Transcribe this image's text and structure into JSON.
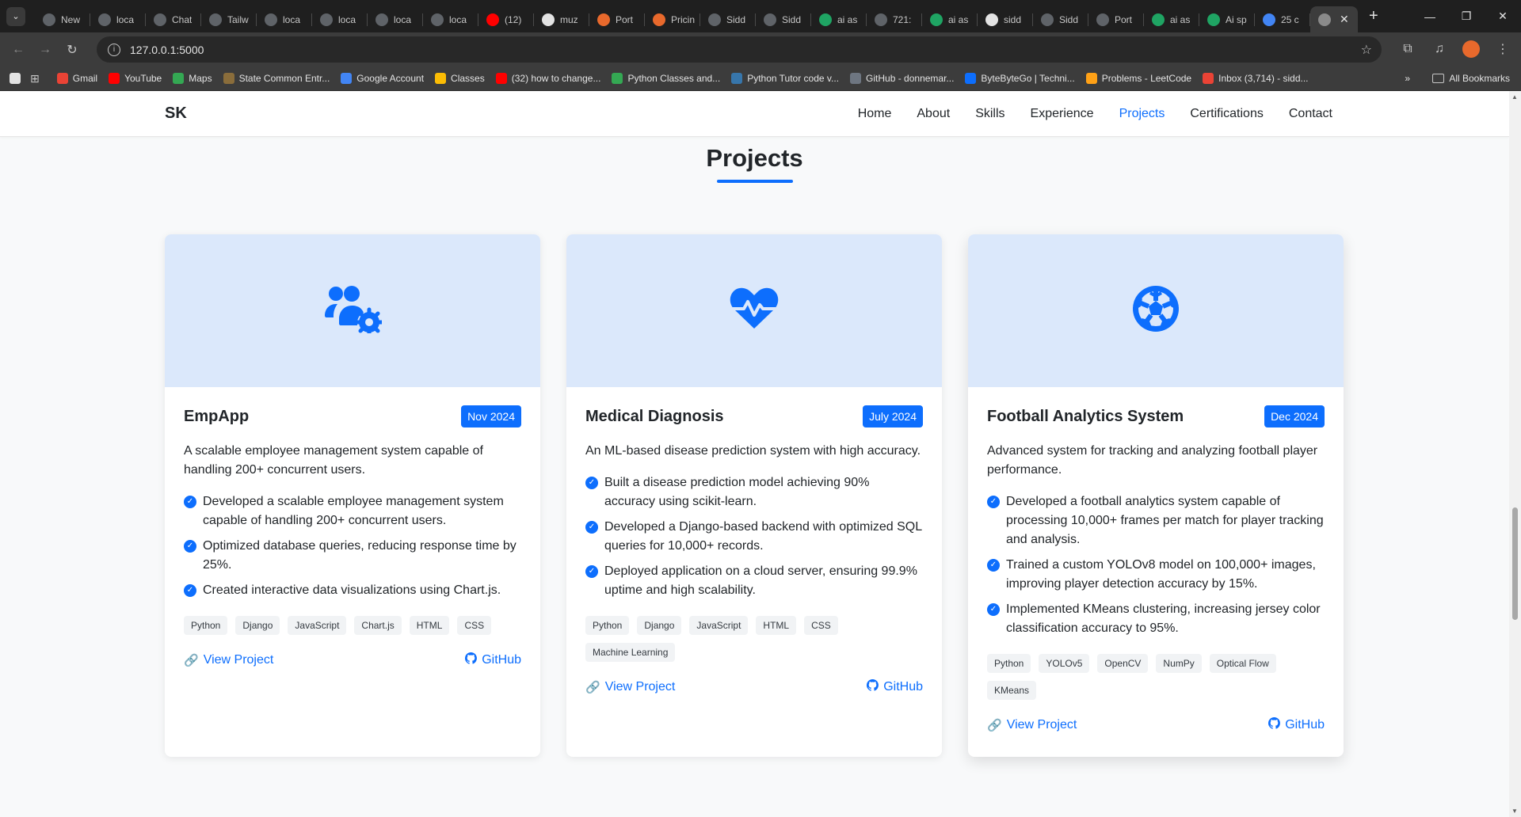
{
  "browser": {
    "tabs": [
      {
        "title": "New",
        "icon": "chrome-icon",
        "color": "#5f6368"
      },
      {
        "title": "loca",
        "icon": "globe-icon",
        "color": "#5f6368"
      },
      {
        "title": "Chat",
        "icon": "openai-icon",
        "color": "#5f6368"
      },
      {
        "title": "Tailw",
        "icon": "openai-icon",
        "color": "#5f6368"
      },
      {
        "title": "loca",
        "icon": "globe-icon",
        "color": "#5f6368"
      },
      {
        "title": "loca",
        "icon": "globe-icon",
        "color": "#5f6368"
      },
      {
        "title": "loca",
        "icon": "globe-icon",
        "color": "#5f6368"
      },
      {
        "title": "loca",
        "icon": "globe-icon",
        "color": "#5f6368"
      },
      {
        "title": "(12)",
        "icon": "youtube-icon",
        "color": "#ff0000"
      },
      {
        "title": "muz",
        "icon": "github-icon",
        "color": "#e3e3e3"
      },
      {
        "title": "Port",
        "icon": "windsurf-icon",
        "color": "#e8692c"
      },
      {
        "title": "Pricin",
        "icon": "windsurf-icon",
        "color": "#e8692c"
      },
      {
        "title": "Sidd",
        "icon": "globe-icon",
        "color": "#5f6368"
      },
      {
        "title": "Sidd",
        "icon": "globe-icon",
        "color": "#5f6368"
      },
      {
        "title": "ai as",
        "icon": "drive-icon",
        "color": "#1fa463"
      },
      {
        "title": "721:",
        "icon": "globe-icon",
        "color": "#5f6368"
      },
      {
        "title": "ai as",
        "icon": "drive-icon",
        "color": "#1fa463"
      },
      {
        "title": "sidd",
        "icon": "github-icon",
        "color": "#e3e3e3"
      },
      {
        "title": "Sidd",
        "icon": "globe-icon",
        "color": "#5f6368"
      },
      {
        "title": "Port",
        "icon": "openai-icon",
        "color": "#5f6368"
      },
      {
        "title": "ai as",
        "icon": "drive-icon",
        "color": "#1fa463"
      },
      {
        "title": "Ai sp",
        "icon": "drive-icon",
        "color": "#1fa463"
      },
      {
        "title": "25 c",
        "icon": "google-icon",
        "color": "#4285f4"
      }
    ],
    "active_tab_icon": "globe-icon",
    "close_glyph": "✕",
    "new_tab_glyph": "+",
    "url": "127.0.0.1:5000",
    "bookmarks": [
      {
        "label": "Gmail",
        "color": "#ea4335"
      },
      {
        "label": "YouTube",
        "color": "#ff0000"
      },
      {
        "label": "Maps",
        "color": "#34a853"
      },
      {
        "label": "State Common Entr...",
        "color": "#8a6d3b"
      },
      {
        "label": "Google Account",
        "color": "#4285f4"
      },
      {
        "label": "Classes",
        "color": "#fbbc04"
      },
      {
        "label": "(32) how to change...",
        "color": "#ff0000"
      },
      {
        "label": "Python Classes and...",
        "color": "#34a853"
      },
      {
        "label": "Python Tutor code v...",
        "color": "#3776ab"
      },
      {
        "label": "GitHub - donnemar...",
        "color": "#6e7681"
      },
      {
        "label": "ByteByteGo | Techni...",
        "color": "#0d6efd"
      },
      {
        "label": "Problems - LeetCode",
        "color": "#ffa116"
      },
      {
        "label": "Inbox (3,714) - sidd...",
        "color": "#ea4335"
      }
    ],
    "bookmarks_more": "»",
    "all_bookmarks": "All Bookmarks"
  },
  "site": {
    "brand": "SK",
    "nav": [
      "Home",
      "About",
      "Skills",
      "Experience",
      "Projects",
      "Certifications",
      "Contact"
    ],
    "active_nav": "Projects",
    "section_title": "Projects",
    "accent": "#0d6efd"
  },
  "projects": [
    {
      "icon": "users-gear-icon",
      "title": "EmpApp",
      "date": "Nov 2024",
      "description": "A scalable employee management system capable of handling 200+ concurrent users.",
      "features": [
        "Developed a scalable employee management system capable of handling 200+ concurrent users.",
        "Optimized database queries, reducing response time by 25%.",
        "Created interactive data visualizations using Chart.js."
      ],
      "tags": [
        "Python",
        "Django",
        "JavaScript",
        "Chart.js",
        "HTML",
        "CSS"
      ],
      "view_label": "View Project",
      "github_label": "GitHub"
    },
    {
      "icon": "heart-pulse-icon",
      "title": "Medical Diagnosis",
      "date": "July 2024",
      "description": "An ML-based disease prediction system with high accuracy.",
      "features": [
        "Built a disease prediction model achieving 90% accuracy using scikit-learn.",
        "Developed a Django-based backend with optimized SQL queries for 10,000+ records.",
        "Deployed application on a cloud server, ensuring 99.9% uptime and high scalability."
      ],
      "tags": [
        "Python",
        "Django",
        "JavaScript",
        "HTML",
        "CSS",
        "Machine Learning"
      ],
      "view_label": "View Project",
      "github_label": "GitHub"
    },
    {
      "icon": "futbol-icon",
      "title": "Football Analytics System",
      "date": "Dec 2024",
      "description": "Advanced system for tracking and analyzing football player performance.",
      "features": [
        "Developed a football analytics system capable of processing 10,000+ frames per match for player tracking and analysis.",
        "Trained a custom YOLOv8 model on 100,000+ images, improving player detection accuracy by 15%.",
        "Implemented KMeans clustering, increasing jersey color classification accuracy to 95%."
      ],
      "tags": [
        "Python",
        "YOLOv5",
        "OpenCV",
        "NumPy",
        "Optical Flow",
        "KMeans"
      ],
      "view_label": "View Project",
      "github_label": "GitHub"
    }
  ]
}
